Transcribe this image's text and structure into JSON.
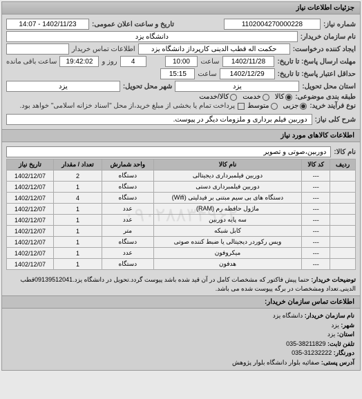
{
  "header": {
    "title": "جزئیات اطلاعات نیاز"
  },
  "top": {
    "req_no_label": "شماره نیاز:",
    "req_no": "1102004270000228",
    "announce_label": "تاریخ و ساعت اعلان عمومی:",
    "announce_val": "1402/11/23 - 14:07",
    "buyer_name_label": "نام سازمان خریدار:",
    "buyer_name": "دانشگاه یزد",
    "creator_label": "ایجاد کننده درخواست:",
    "creator": "حکمت اله قطب الدینی کارپرداز دانشگاه یزد",
    "contact_label": "اطلاعات تماس خریدار",
    "deadline_label": "مهلت ارسال پاسخ: تا تاریخ:",
    "deadline_date": "1402/11/28",
    "time_label": "ساعت",
    "deadline_time": "10:00",
    "remaining_days": "4",
    "remaining_days_label": "روز و",
    "remaining_time": "19:42:02",
    "remaining_suffix": "ساعت باقی مانده",
    "min_valid_label": "حداقل اعتبار پاسخ: تا تاریخ:",
    "min_valid_date": "1402/12/29",
    "min_valid_time": "15:15",
    "delivery_prov_label": "استان محل تحویل:",
    "delivery_prov": "یزد",
    "delivery_city_label": "شهر محل تحویل:",
    "delivery_city": "یزد",
    "budget_label": "طبقه بندی موضوعی:",
    "budget_opts": {
      "a": "کالا",
      "b": "خدمت",
      "c": "کالا/خدمت"
    },
    "process_label": "نوع فرآیند خرید:",
    "process_opts": {
      "a": "جزیی",
      "b": "متوسط"
    },
    "process_note": "پرداخت تمام یا بخشی از مبلغ خرید،از محل \"اسناد خزانه اسلامی\" خواهد بود.",
    "desc_label": "شرح کلی نیاز:",
    "desc": "دوربین فیلم برداری و ملزومات دیگر در پیوست."
  },
  "items_header": "اطلاعات کالاهای مورد نیاز",
  "items_name_label": "نام کالا:",
  "items_name": "دوربین،صوتی و تصویر",
  "table": {
    "headers": {
      "row": "ردیف",
      "code": "کد کالا",
      "name": "نام کالا",
      "unit": "واحد شمارش",
      "qty": "تعداد / مقدار",
      "date": "تاریخ نیاز"
    },
    "rows": [
      {
        "code": "---",
        "name": "دوربین فیلمبرداری دیجیتالی",
        "unit": "دستگاه",
        "qty": "2",
        "date": "1402/12/07"
      },
      {
        "code": "---",
        "name": "دوربین فیلمبرداری دستی",
        "unit": "دستگاه",
        "qty": "1",
        "date": "1402/12/07"
      },
      {
        "code": "---",
        "name": "دستگاه های بی سیم مبتنی بر فیدلیتی (Wifi)",
        "unit": "دستگاه",
        "qty": "4",
        "date": "1402/12/07"
      },
      {
        "code": "---",
        "name": "ماژول حافظه رم (RAM)",
        "unit": "عدد",
        "qty": "1",
        "date": "1402/12/07"
      },
      {
        "code": "---",
        "name": "سه پایه دوربین",
        "unit": "عدد",
        "qty": "1",
        "date": "1402/12/07"
      },
      {
        "code": "---",
        "name": "کابل شبکه",
        "unit": "متر",
        "qty": "1",
        "date": "1402/12/07"
      },
      {
        "code": "---",
        "name": "ویس رکوردر دیجیتالی یا ضبط کننده صوتی",
        "unit": "دستگاه",
        "qty": "1",
        "date": "1402/12/07"
      },
      {
        "code": "---",
        "name": "میکروفون",
        "unit": "عدد",
        "qty": "1",
        "date": "1402/12/07"
      },
      {
        "code": "---",
        "name": "هدفون",
        "unit": "دستگاه",
        "qty": "1",
        "date": "1402/12/07"
      }
    ]
  },
  "note_label": "توضیحات خریدار:",
  "note": "حتما پیش فاکتور که مشخصات کامل در آن قید شده باشد پیوست گردد.تحویل در دانشگاه یزد.09139512041قطب الدینی.تعداد ومشخصات در برگه پیوست شده می باشد.",
  "footer": {
    "title": "اطلاعات تماس سازمان خریدار:",
    "org_label": "نام سازمان خریدار:",
    "org": "دانشگاه یزد",
    "city_label": "شهر:",
    "city": "یزد",
    "prov_label": "استان:",
    "prov": "یزد",
    "tel_label": "تلفن ثابت:",
    "tel": "38211829-035",
    "fax_label": "دورنگار:",
    "fax": "31232222-035",
    "addr_label": "آدرس پستی:",
    "addr": "صفائيه بلوار دانشگاه بلوار پژوهش"
  },
  "watermark": "۰۹۰۲۸۸۳۴۹۶۲"
}
